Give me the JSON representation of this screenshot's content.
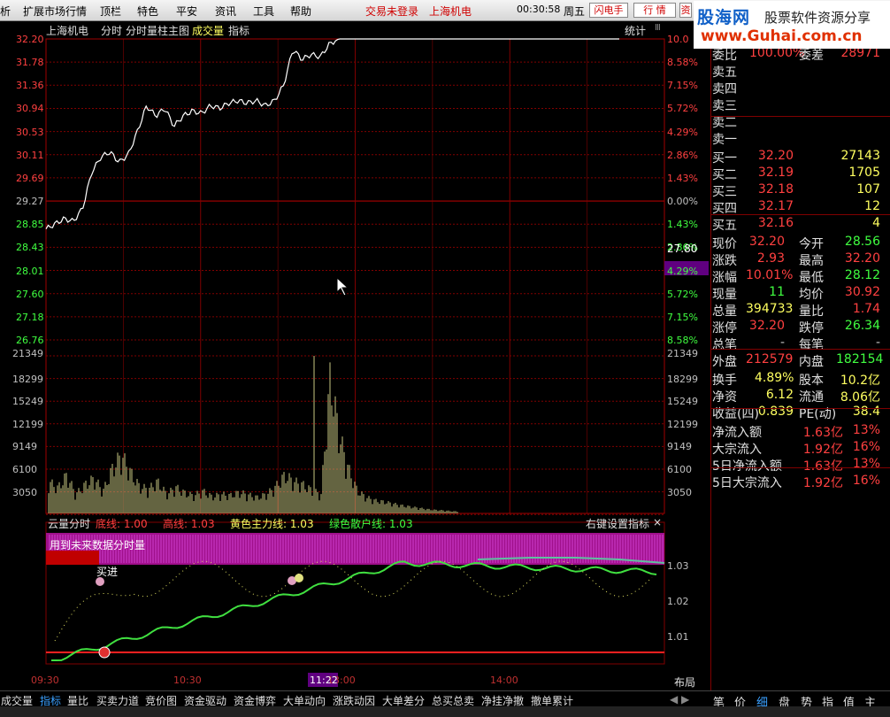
{
  "menu": {
    "items": [
      "析",
      "扩展市场行情",
      "顶栏",
      "特色",
      "平安",
      "资讯",
      "工具",
      "帮助"
    ],
    "status_login": "交易未登录",
    "stock_name": "上海机电",
    "time": "00:30:58",
    "weekday": "周五",
    "btn_flash": "闪电手",
    "btn_quote": "行 情",
    "btn_extra": "资"
  },
  "brand": {
    "name": "股海网",
    "slogan": "股票软件资源分享",
    "url": "www.Guhai.com.cn"
  },
  "chart_header": {
    "stock": "上海机电",
    "m1": "分时",
    "m2": "分时量柱主图",
    "m3": "成交量",
    "m4": "指标",
    "stat": "统计",
    "box": "Ⅲ"
  },
  "price_axis": [
    "32.20",
    "31.78",
    "31.36",
    "30.94",
    "30.53",
    "30.11",
    "29.69",
    "29.27",
    "28.85",
    "28.43",
    "28.01",
    "27.60",
    "27.18",
    "26.76"
  ],
  "pct_axis": [
    "10.0",
    "8.58%",
    "7.15%",
    "5.72%",
    "4.29%",
    "2.86%",
    "1.43%",
    "0.00%",
    "1.43%",
    "2.86%",
    "4.29%",
    "5.72%",
    "7.15%",
    "8.58%"
  ],
  "vol_axis": [
    "21349",
    "18299",
    "15249",
    "12199",
    "9149",
    "6100",
    "3050"
  ],
  "cursor_price": "27.80",
  "indicator": {
    "title": "云量分时",
    "lines": [
      {
        "label": "底线:",
        "value": "1.00",
        "color": "#ff4040"
      },
      {
        "label": "高线:",
        "value": "1.03",
        "color": "#ff4040"
      },
      {
        "label": "黄色主力线:",
        "value": "1.03",
        "color": "#ffff60"
      },
      {
        "label": "绿色散户线:",
        "value": "1.03",
        "color": "#40ff40"
      }
    ],
    "right_hint": "右键设置指标",
    "close": "×",
    "note": "用到未来数据分时量",
    "buy_label": "买进",
    "axis": [
      "1.03",
      "1.02",
      "1.01"
    ]
  },
  "time_axis": {
    "t0": "09:30",
    "t1": "10:30",
    "t2": "11:22",
    "t3": "13:00",
    "t4": "14:00",
    "layout": "布局"
  },
  "quote": {
    "wb": {
      "l": "委比",
      "v": "100.00%",
      "l2": "委差",
      "v2": "28971"
    },
    "sells": [
      {
        "l": "卖五"
      },
      {
        "l": "卖四"
      },
      {
        "l": "卖三"
      },
      {
        "l": "卖二"
      },
      {
        "l": "卖一"
      }
    ],
    "buys": [
      {
        "l": "买一",
        "p": "32.20",
        "q": "27143"
      },
      {
        "l": "买二",
        "p": "32.19",
        "q": "1705"
      },
      {
        "l": "买三",
        "p": "32.18",
        "q": "107"
      },
      {
        "l": "买四",
        "p": "32.17",
        "q": "12"
      },
      {
        "l": "买五",
        "p": "32.16",
        "q": "4"
      }
    ],
    "stats": [
      {
        "a": "现价",
        "av": "32.20",
        "ac": "#ff4040",
        "b": "今开",
        "bv": "28.56",
        "bc": "#40ff40"
      },
      {
        "a": "涨跌",
        "av": "2.93",
        "ac": "#ff4040",
        "b": "最高",
        "bv": "32.20",
        "bc": "#ff4040"
      },
      {
        "a": "涨幅",
        "av": "10.01%",
        "ac": "#ff4040",
        "b": "最低",
        "bv": "28.12",
        "bc": "#40ff40"
      },
      {
        "a": "现量",
        "av": "11",
        "ac": "#40ff40",
        "b": "均价",
        "bv": "30.92",
        "bc": "#ff4040"
      },
      {
        "a": "总量",
        "av": "394733",
        "ac": "#ffff60",
        "b": "量比",
        "bv": "1.74",
        "bc": "#ff4040"
      },
      {
        "a": "涨停",
        "av": "32.20",
        "ac": "#ff4040",
        "b": "跌停",
        "bv": "26.34",
        "bc": "#40ff40"
      },
      {
        "a": "总笔",
        "av": "-",
        "ac": "#c0c0c0",
        "b": "每笔",
        "bv": "-",
        "bc": "#c0c0c0"
      },
      {
        "a": "外盘",
        "av": "212579",
        "ac": "#ff4040",
        "b": "内盘",
        "bv": "182154",
        "bc": "#40ff40"
      }
    ],
    "stats2": [
      {
        "a": "换手",
        "av": "4.89%",
        "ac": "#ffff60",
        "b": "股本",
        "bv": "10.2亿",
        "bc": "#ffff60"
      },
      {
        "a": "净资",
        "av": "6.12",
        "ac": "#ffff60",
        "b": "流通",
        "bv": "8.06亿",
        "bc": "#ffff60"
      },
      {
        "a": "收益(四)",
        "av": "0.839",
        "ac": "#ffff60",
        "b": "PE(动)",
        "bv": "38.4",
        "bc": "#ffff60"
      }
    ],
    "flows": [
      {
        "l": "净流入额",
        "v": "1.63亿",
        "p": "13%"
      },
      {
        "l": "大宗流入",
        "v": "1.92亿",
        "p": "16%"
      },
      {
        "l": "5日净流入额",
        "v": "1.63亿",
        "p": "13%"
      },
      {
        "l": "5日大宗流入",
        "v": "1.92亿",
        "p": "16%"
      }
    ]
  },
  "bottom_tabs": [
    {
      "label": "成交量",
      "sel": false
    },
    {
      "label": "指标",
      "sel": true
    },
    {
      "label": "量比",
      "sel": false
    },
    {
      "label": "买卖力道",
      "sel": false
    },
    {
      "label": "竞价图",
      "sel": false
    },
    {
      "label": "资金驱动",
      "sel": false
    },
    {
      "label": "资金博弈",
      "sel": false
    },
    {
      "label": "大单动向",
      "sel": false
    },
    {
      "label": "涨跌动因",
      "sel": false
    },
    {
      "label": "大单差分",
      "sel": false
    },
    {
      "label": "总买总卖",
      "sel": false
    },
    {
      "label": "净挂净撤",
      "sel": false
    },
    {
      "label": "撤单累计",
      "sel": false
    }
  ],
  "right_tabs": [
    "笔",
    "价",
    "细",
    "盘",
    "势",
    "指",
    "值",
    "主"
  ],
  "colors": {
    "up": "#ff4040",
    "down": "#40ff40",
    "grid": "#800000",
    "line": "#ffffff",
    "avg": "#ffff60",
    "volume": "#c8c882"
  },
  "chart_data": {
    "type": "line",
    "title": "上海机电",
    "y_range": [
      26.34,
      32.2
    ],
    "price": [
      28.5,
      28.6,
      28.7,
      28.65,
      28.9,
      29.6,
      29.9,
      30.0,
      29.8,
      29.95,
      30.4,
      30.9,
      30.7,
      30.85,
      30.5,
      30.7,
      30.8,
      30.75,
      30.9,
      30.85,
      30.95,
      31.0,
      30.95,
      31.0,
      30.9,
      31.0,
      31.3,
      32.0,
      31.8,
      31.9,
      31.85,
      32.1,
      32.2,
      32.2,
      32.2,
      32.2,
      32.2,
      32.2,
      32.2,
      32.2,
      32.2,
      32.2,
      32.2,
      32.2,
      32.2,
      32.2
    ],
    "volume": [
      5000,
      4000,
      6000,
      3000,
      4500,
      5500,
      3500,
      7000,
      9149,
      6500,
      4200,
      3800,
      5000,
      3000,
      4100,
      3200,
      2800,
      3500,
      2600,
      3000,
      2800,
      3300,
      2900,
      2500,
      3000,
      4200,
      6000,
      5000,
      4500,
      3600,
      3000,
      21349,
      12199,
      7000,
      3500,
      2500,
      2000,
      1800,
      1500,
      1200,
      1000,
      800,
      600,
      500,
      400,
      300
    ]
  }
}
